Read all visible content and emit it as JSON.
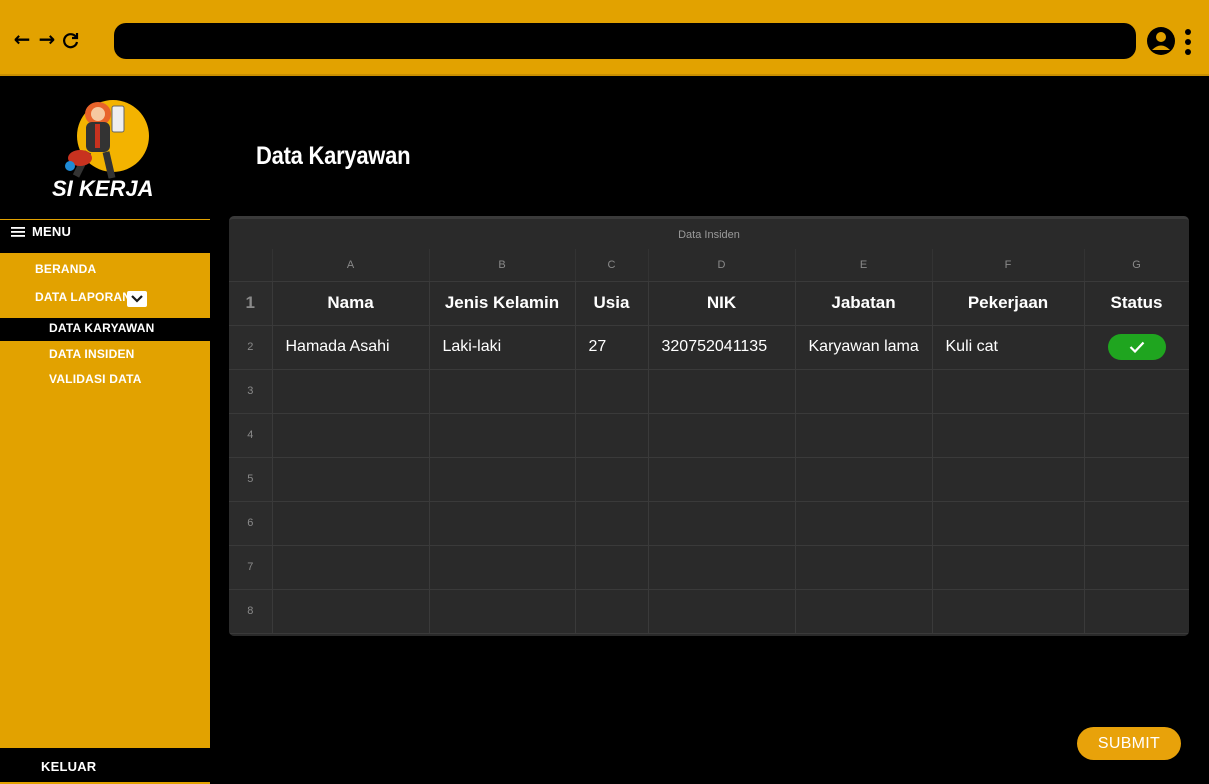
{
  "browser": {
    "back_icon": "←",
    "forward_icon": "→",
    "reload_icon": "C",
    "url": "",
    "profile_icon": "user-circle-icon",
    "menu_icon": "kebab-icon"
  },
  "sidebar": {
    "logo_text": "SI KERJA",
    "menu_label": "MENU",
    "items": [
      {
        "label": "BERANDA"
      },
      {
        "label": "DATA LAPORAN"
      },
      {
        "label": "DATA KARYAWAN"
      },
      {
        "label": "DATA INSIDEN"
      },
      {
        "label": "VALIDASI DATA"
      }
    ],
    "logout_label": "KELUAR"
  },
  "main": {
    "title": "Data Karyawan",
    "sheet_title": "Data Insiden",
    "column_letters": [
      "A",
      "B",
      "C",
      "D",
      "E",
      "F",
      "G"
    ],
    "row_numbers": [
      "1",
      "2",
      "3",
      "4",
      "5",
      "6",
      "7",
      "8"
    ],
    "headers": [
      "Nama",
      "Jenis Kelamin",
      "Usia",
      "NIK",
      "Jabatan",
      "Pekerjaan",
      "Status"
    ],
    "row2": {
      "nama": "Hamada Asahi",
      "jenis_kelamin": "Laki-laki",
      "usia": "27",
      "nik": "320752041135",
      "jabatan": "Karyawan lama",
      "pekerjaan": "Kuli cat",
      "status": "check"
    },
    "submit_label": "SUBMIT"
  },
  "colors": {
    "accent": "#e2a200",
    "status_ok": "#1fa51f",
    "sheet_bg": "#2a2a2a"
  }
}
